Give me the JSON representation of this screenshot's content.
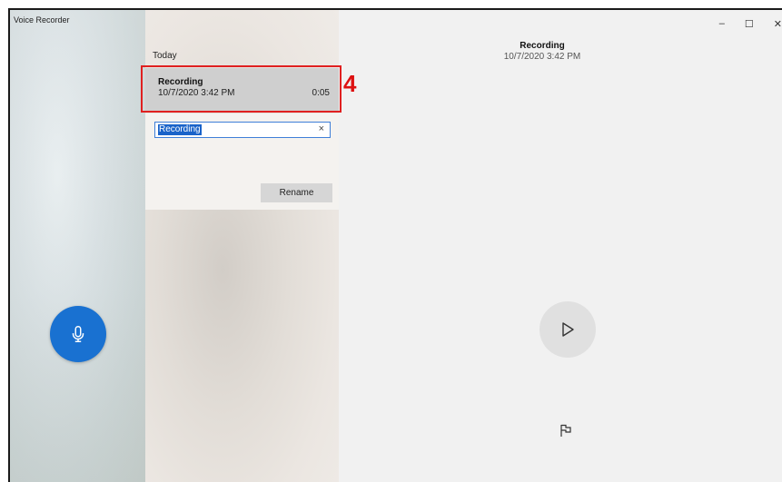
{
  "app": {
    "title": "Voice Recorder"
  },
  "list": {
    "section_header": "Today",
    "items": [
      {
        "title": "Recording",
        "date": "10/7/2020 3:42 PM",
        "duration": "0:05"
      }
    ]
  },
  "rename": {
    "input_value": "Recording",
    "clear_symbol": "×",
    "button_label": "Rename"
  },
  "annotation": {
    "step_number": "4",
    "color": "#e02020"
  },
  "player": {
    "title": "Recording",
    "date": "10/7/2020 3:42 PM"
  },
  "window_controls": {
    "minimize": "–",
    "maximize": "☐",
    "close": "✕"
  },
  "icons": {
    "record": "microphone-icon",
    "play": "play-icon",
    "marker": "flag-icon"
  },
  "colors": {
    "accent": "#1971d1",
    "selected_row": "#cfcfcf"
  }
}
